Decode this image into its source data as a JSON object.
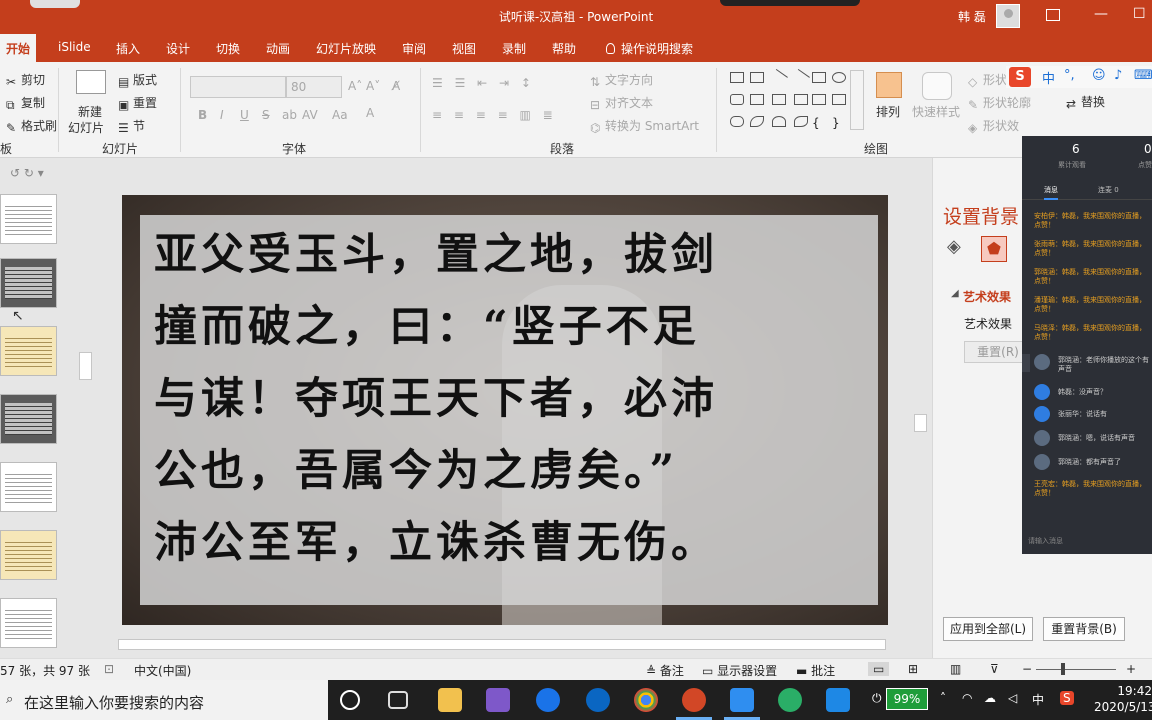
{
  "app": {
    "title": "试听课-汉高祖 - PowerPoint",
    "user": "韩 磊",
    "window_controls": [
      "—",
      "☐",
      "✕"
    ]
  },
  "tabs": [
    "开始",
    "iSlide",
    "插入",
    "设计",
    "切换",
    "动画",
    "幻灯片放映",
    "审阅",
    "视图",
    "录制",
    "帮助",
    "操作说明搜索"
  ],
  "ribbon": {
    "clipboard": {
      "cut": "剪切",
      "copy": "复制",
      "format_painter": "格式刷",
      "group_partial": "板"
    },
    "slides": {
      "new_slide": "新建",
      "new_slide_2": "幻灯片",
      "layout": "版式",
      "reset": "重置",
      "section": "节",
      "group": "幻灯片"
    },
    "font": {
      "font_size": "80",
      "group": "字体",
      "btns": [
        "B",
        "I",
        "U",
        "S",
        "ab",
        "AV",
        "Aa"
      ]
    },
    "paragraph": {
      "text_direction": "文字方向",
      "align_text": "对齐文本",
      "smartart": "转换为 SmartArt",
      "group": "段落"
    },
    "drawing": {
      "arrange": "排列",
      "quick_styles": "快速样式",
      "shape_fill": "形状",
      "shape_outline": "形状轮廓",
      "shape_effects": "形状效",
      "group": "绘图"
    },
    "editing": {
      "replace": "替换"
    }
  },
  "slide": {
    "lines": [
      "亚父受玉斗，置之地，拔剑",
      "撞而破之，曰：“竖子不足",
      "与谋！夺项王天下者，必沛",
      "公也，吾属今为之虏矣。”",
      "沛公至军，立诛杀曹无伤。"
    ]
  },
  "format_pane": {
    "title": "设置背景",
    "section": "艺术效果",
    "item": "艺术效果",
    "reset_button": "重置(R)",
    "apply_all": "应用到全部(L)",
    "reset_bg": "重置背景(B)"
  },
  "chat": {
    "viewers": "6",
    "viewers_label": "累计观看",
    "second_value": "0",
    "second_label": "点赞",
    "tab_msgs": "消息",
    "tab_others": "连麦 0",
    "messages": [
      "安柏伊：韩磊，我来围观你的直播，点赞！",
      "张雨萌：韩磊，我来围观你的直播，点赞！",
      "郭晓涵：韩磊，我来围观你的直播，点赞！",
      "潘瑾瑜：韩磊，我来围观你的直播，点赞！",
      "马晓泽：韩磊，我来围观你的直播，点赞！",
      "郭晓涵：老师你播放的这个有声音",
      "韩磊：没声音？",
      "张丽华：说话有",
      "郭晓涵：嗯，说话有声音",
      "郭晓涵：都有声音了",
      "王亮宏：韩磊，我来围观你的直播，点赞！"
    ],
    "input_placeholder": "请输入消息"
  },
  "ime": {
    "label": "中"
  },
  "status": {
    "slide_count": "57 张，共 97 张",
    "language": "中文(中国)",
    "notes": "备注",
    "display": "显示器设置",
    "comments": "批注"
  },
  "taskbar": {
    "search_placeholder": "在这里输入你要搜索的内容",
    "battery": "99%",
    "ime": "中",
    "time": "19:42",
    "date": "2020/5/13"
  },
  "colors": {
    "accent": "#c43e1c",
    "chat_bg": "#2c2f36",
    "taskbar": "#1f1f1f"
  }
}
